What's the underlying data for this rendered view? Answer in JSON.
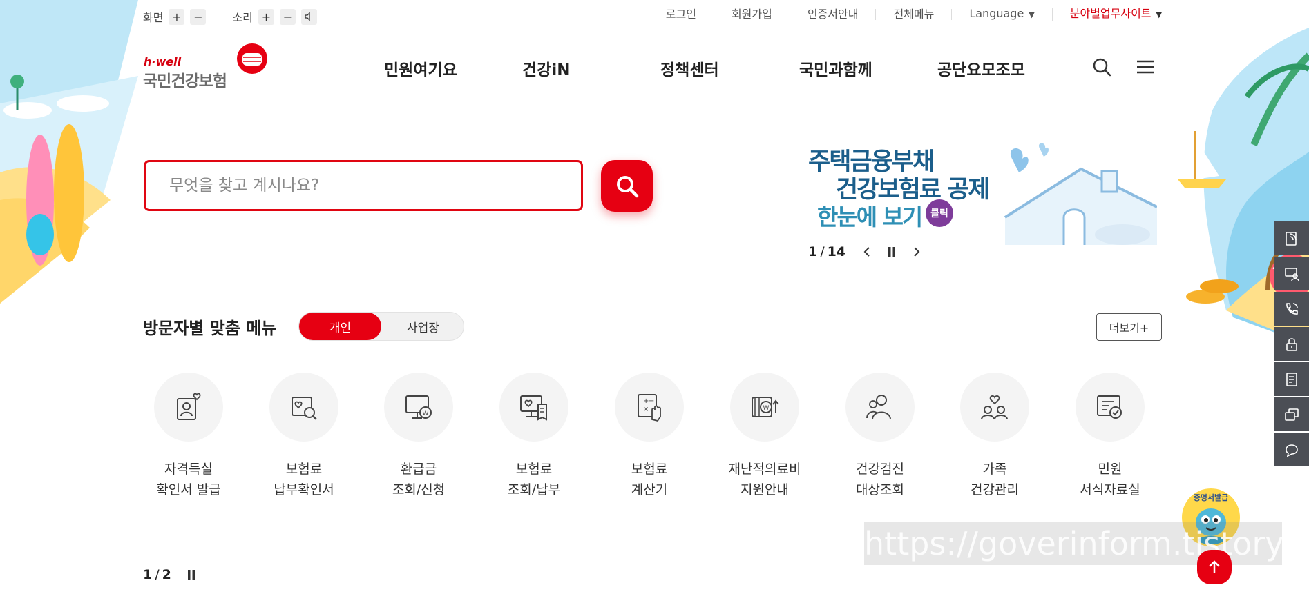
{
  "topbar": {
    "screen_label": "화면",
    "sound_label": "소리",
    "plus": "+",
    "minus": "−",
    "links": [
      "로그인",
      "회원가입",
      "인증서안내",
      "전체메뉴"
    ],
    "language": "Language",
    "site_link": "분야별업무사이트"
  },
  "logo": {
    "brand_small": "h·well",
    "brand_main": "국민건강보험"
  },
  "gnb": [
    "민원여기요",
    "건강iN",
    "정책센터",
    "국민과함께",
    "공단요모조모"
  ],
  "search": {
    "placeholder": "무엇을 찾고 계시나요?"
  },
  "banner": {
    "line1": "주택금융부채",
    "line2": "건강보험료 공제",
    "line3": "한눈에 보기",
    "badge": "클릭",
    "current": "1",
    "separator": "/",
    "total": "14"
  },
  "visitor_menu": {
    "title": "방문자별 맞춤 메뉴",
    "tab_active": "개인",
    "tab_inactive": "사업장",
    "more": "더보기+",
    "items": [
      {
        "l1": "자격득실",
        "l2": "확인서 발급",
        "icon": "person-heart-icon"
      },
      {
        "l1": "보험료",
        "l2": "납부확인서",
        "icon": "document-search-icon"
      },
      {
        "l1": "환급금",
        "l2": "조회/신청",
        "icon": "monitor-won-icon"
      },
      {
        "l1": "보험료",
        "l2": "조회/납부",
        "icon": "monitor-receipt-icon"
      },
      {
        "l1": "보험료",
        "l2": "계산기",
        "icon": "calculator-hand-icon"
      },
      {
        "l1": "재난적의료비",
        "l2": "지원안내",
        "icon": "wallet-won-icon"
      },
      {
        "l1": "건강검진",
        "l2": "대상조회",
        "icon": "people-icon"
      },
      {
        "l1": "가족",
        "l2": "건강관리",
        "icon": "family-heart-icon"
      },
      {
        "l1": "민원",
        "l2": "서식자료실",
        "icon": "form-check-icon"
      }
    ],
    "pager_current": "1",
    "pager_sep": "/",
    "pager_total": "2"
  },
  "mascot_label": "증명서발급",
  "watermark": "https://goverinform.tistory.com",
  "colors": {
    "brand_red": "#e60012",
    "quickbar": "#4b4e55",
    "banner_blue": "#1b5e8b"
  }
}
